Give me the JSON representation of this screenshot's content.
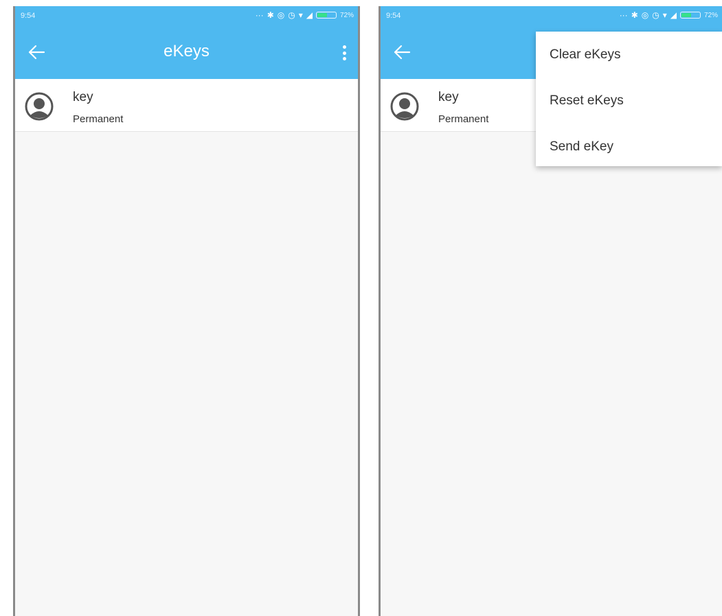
{
  "status_bar": {
    "time": "9:54",
    "battery_left": "72%",
    "battery_right": "72%"
  },
  "toolbar": {
    "title": "eKeys",
    "back_icon": "arrow-left-icon",
    "menu_icon": "more-vert-icon"
  },
  "key_list": [
    {
      "name": "key",
      "type": "Permanent",
      "icon": "person-avatar-icon"
    }
  ],
  "overflow_menu": {
    "items": [
      "Clear eKeys",
      "Reset eKeys",
      "Send eKey"
    ]
  },
  "colors": {
    "primary": "#4eb9f0",
    "background": "#f7f7f7",
    "text": "#333333"
  }
}
